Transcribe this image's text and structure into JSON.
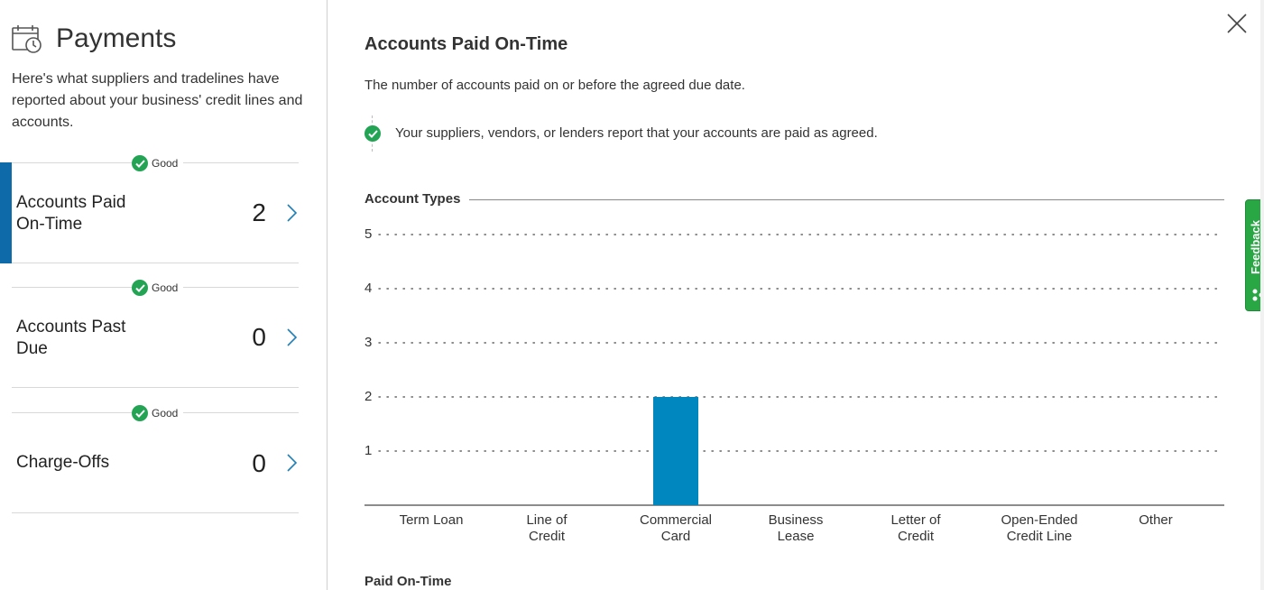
{
  "left_panel": {
    "title": "Payments",
    "icon": "calendar-clock-icon",
    "description": "Here's what suppliers and tradelines have reported about your business' credit lines and accounts."
  },
  "metrics": [
    {
      "status": "Good",
      "label_line1": "Accounts Paid",
      "label_line2": "On-Time",
      "count": "2",
      "active": true
    },
    {
      "status": "Good",
      "label_line1": "Accounts Past",
      "label_line2": "Due",
      "count": "0",
      "active": false
    },
    {
      "status": "Good",
      "label_line1": "Charge-Offs",
      "label_line2": "",
      "count": "0",
      "active": false
    }
  ],
  "detail": {
    "title": "Accounts Paid On-Time",
    "description": "The number of accounts paid on or before the agreed due date.",
    "status_text": "Your suppliers, vendors, or lenders report that your accounts are paid as agreed.",
    "section_title": "Account Types",
    "next_section_title": "Paid On-Time"
  },
  "feedback_label": "Feedback",
  "colors": {
    "accent": "#0e6aa8",
    "bar": "#0087bf",
    "good": "#23a455",
    "feedback": "#2aa745"
  },
  "chart_data": {
    "type": "bar",
    "categories": [
      [
        "Term Loan"
      ],
      [
        "Line of",
        "Credit"
      ],
      [
        "Commercial",
        "Card"
      ],
      [
        "Business",
        "Lease"
      ],
      [
        "Letter of",
        "Credit"
      ],
      [
        "Open-Ended",
        "Credit Line"
      ],
      [
        "Other"
      ]
    ],
    "values": [
      0,
      0,
      2,
      0,
      0,
      0,
      0
    ],
    "yticks": [
      1,
      2,
      3,
      4,
      5
    ],
    "ylim": [
      0,
      5
    ],
    "grid": true
  }
}
